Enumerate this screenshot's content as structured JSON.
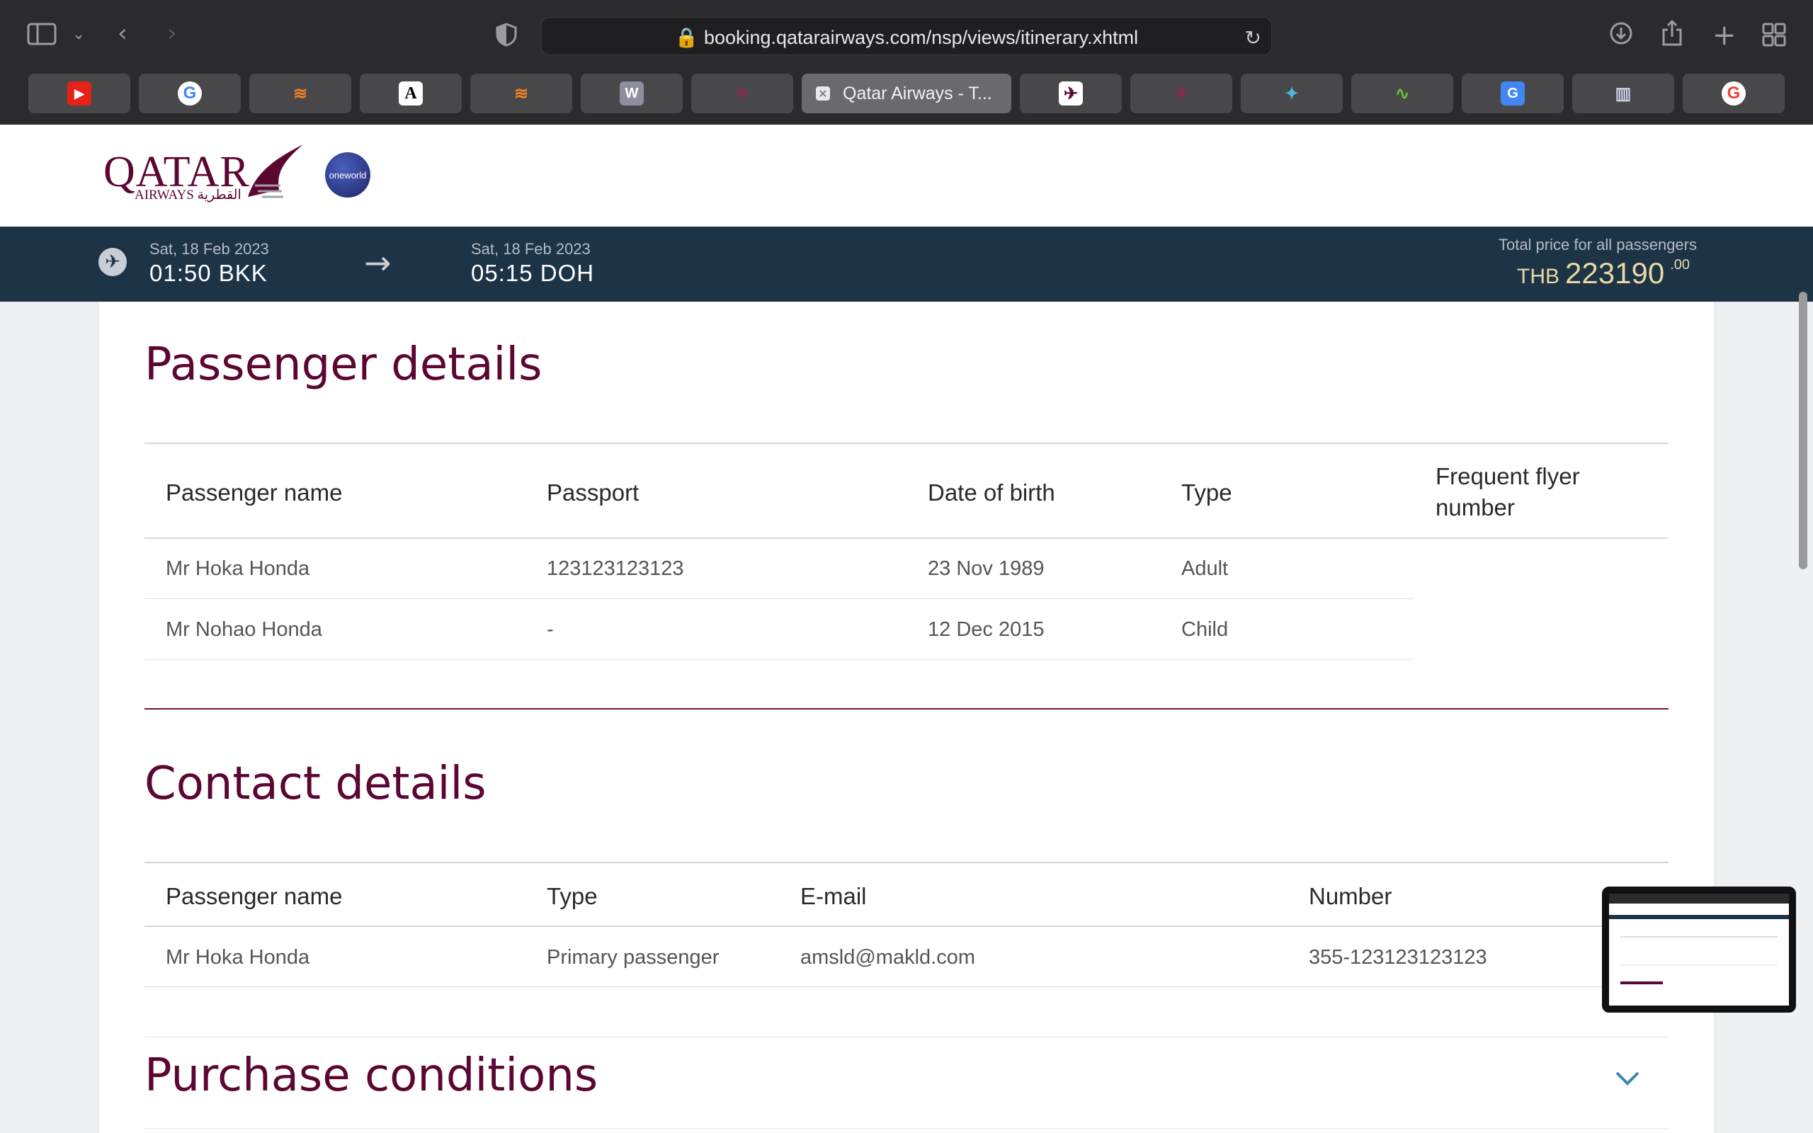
{
  "browser": {
    "url": "booking.qatarairways.com/nsp/views/itinerary.xhtml",
    "active_tab_title": "Qatar Airways - T...",
    "tabs": [
      {
        "icon": "youtube-icon"
      },
      {
        "icon": "google-icon"
      },
      {
        "icon": "stackoverflow-icon"
      },
      {
        "icon": "a-icon"
      },
      {
        "icon": "stackoverflow-icon"
      },
      {
        "icon": "wiki-icon"
      },
      {
        "icon": "qatar-icon"
      },
      {
        "icon": "qatar-active-tab"
      },
      {
        "icon": "qatar-icon"
      },
      {
        "icon": "qatar-icon"
      },
      {
        "icon": "bird-icon"
      },
      {
        "icon": "chart-icon"
      },
      {
        "icon": "translate-icon"
      },
      {
        "icon": "reader-icon"
      },
      {
        "icon": "google-icon"
      }
    ]
  },
  "site": {
    "logo_text": "QATAR",
    "logo_sub": "AIRWAYS القطرية",
    "alliance": "oneworld"
  },
  "flight": {
    "depart_date": "Sat, 18 Feb 2023",
    "depart_time": "01:50 BKK",
    "arrive_date": "Sat, 18 Feb 2023",
    "arrive_time": "05:15 DOH",
    "total_label": "Total price for all passengers",
    "currency": "THB",
    "amount": "223190",
    "decimals": ".00"
  },
  "passenger_details": {
    "title": "Passenger details",
    "headers": {
      "name": "Passenger name",
      "passport": "Passport",
      "dob": "Date of birth",
      "type": "Type",
      "ff_line1": "Frequent flyer",
      "ff_line2": "number"
    },
    "rows": [
      {
        "name": "Mr Hoka Honda",
        "passport": "123123123123",
        "dob": "23 Nov 1989",
        "type": "Adult"
      },
      {
        "name": "Mr Nohao Honda",
        "passport": "-",
        "dob": "12 Dec 2015",
        "type": "Child"
      }
    ]
  },
  "contact_details": {
    "title": "Contact details",
    "headers": {
      "name": "Passenger name",
      "type": "Type",
      "email": "E-mail",
      "number": "Number"
    },
    "rows": [
      {
        "name": "Mr Hoka Honda",
        "type": "Primary passenger",
        "email": "amsld@makld.com",
        "number": "355-123123123123"
      }
    ]
  },
  "purchase_conditions": {
    "title": "Purchase conditions"
  },
  "colors": {
    "brand_maroon": "#5c0632",
    "flight_bar": "#1d3346",
    "price_gold": "#e8d9a4",
    "chevron_blue": "#3d87b5"
  }
}
